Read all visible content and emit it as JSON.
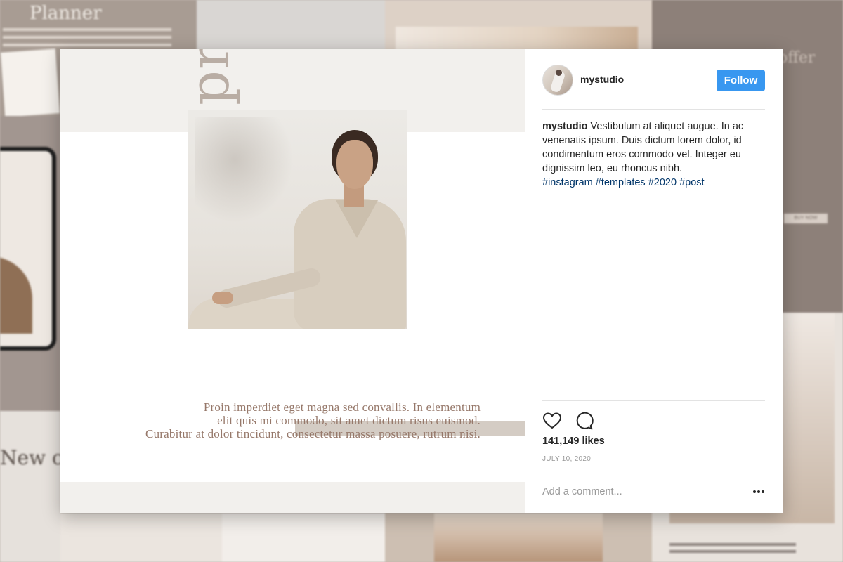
{
  "background": {
    "planner_title": "Planner",
    "offer_title": "offer",
    "buy_label": "BUY NOW",
    "newcol_title": "New co"
  },
  "post": {
    "vertical_title": "profile",
    "quote_lines": [
      "Proin imperdiet eget magna sed convallis. In elementum",
      "elit quis mi commodo, sit amet dictum risus euismod.",
      "Curabitur at dolor tincidunt, consectetur massa posuere, rutrum nisi."
    ]
  },
  "header": {
    "username": "mystudio",
    "follow_label": "Follow"
  },
  "caption": {
    "username": "mystudio",
    "text": "Vestibulum at aliquet augue. In ac venenatis ipsum. Duis dictum lorem dolor, id condimentum eros commodo vel. Integer eu dignissim leo, eu rhoncus nibh.",
    "hashtags": "#instagram #templates #2020 #post"
  },
  "stats": {
    "likes": "141,149 likes",
    "date": "JULY 10, 2020"
  },
  "comment": {
    "placeholder": "Add a comment..."
  },
  "colors": {
    "follow_button": "#3897f0",
    "hashtag": "#003569",
    "title_taupe": "#b9ada4",
    "quote_text": "#96786a"
  },
  "icons": {
    "like": "heart-outline",
    "comment": "speech-bubble",
    "more": "three-dots"
  }
}
